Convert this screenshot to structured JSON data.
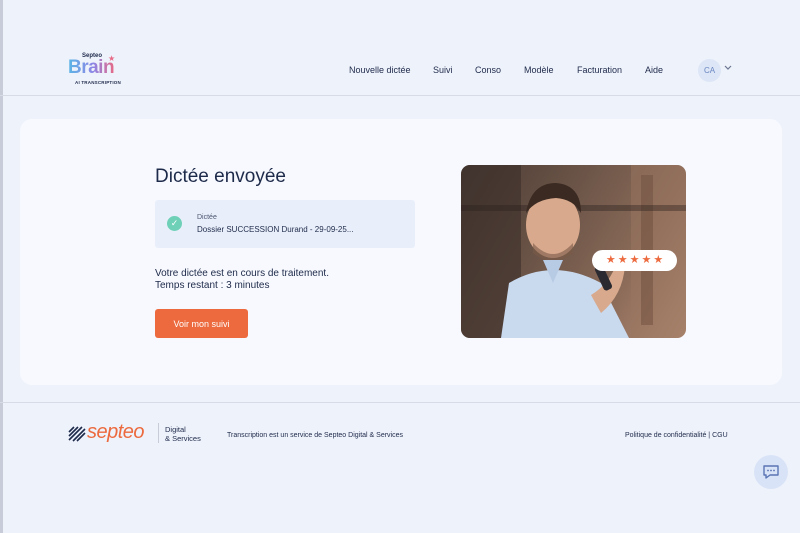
{
  "header": {
    "logo": {
      "small": "Septeo",
      "brand": "Brain",
      "sub": "AI TRANSCRIPTION"
    },
    "nav": [
      {
        "label": "Nouvelle dictée"
      },
      {
        "label": "Suivi"
      },
      {
        "label": "Conso"
      },
      {
        "label": "Modèle"
      },
      {
        "label": "Facturation"
      },
      {
        "label": "Aide"
      }
    ],
    "avatar_initials": "CA"
  },
  "main": {
    "title": "Dictée envoyée",
    "dictation": {
      "label": "Dictée",
      "value": "Dossier SUCCESSION Durand - 29-09-25..."
    },
    "status_line1": "Votre dictée est en cours de traitement.",
    "status_line2": "Temps restant : 3 minutes",
    "cta_label": "Voir mon suivi",
    "rating_stars": 5
  },
  "footer": {
    "logo_text": "septeo",
    "logo_sub1": "Digital",
    "logo_sub2": "& Services",
    "description": "Transcription est un service de Septeo Digital & Services",
    "privacy_link": "Politique de confidentialité",
    "separator": "|",
    "cgu_link": "CGU"
  },
  "colors": {
    "accent": "#ec6a3e",
    "success": "#6fd0b8",
    "background": "#eef2fb",
    "text": "#1e2a4a"
  },
  "icons": {
    "check": "check-circle-icon",
    "chevron": "chevron-down-icon",
    "chat": "chat-bubble-icon",
    "star": "star-icon"
  }
}
